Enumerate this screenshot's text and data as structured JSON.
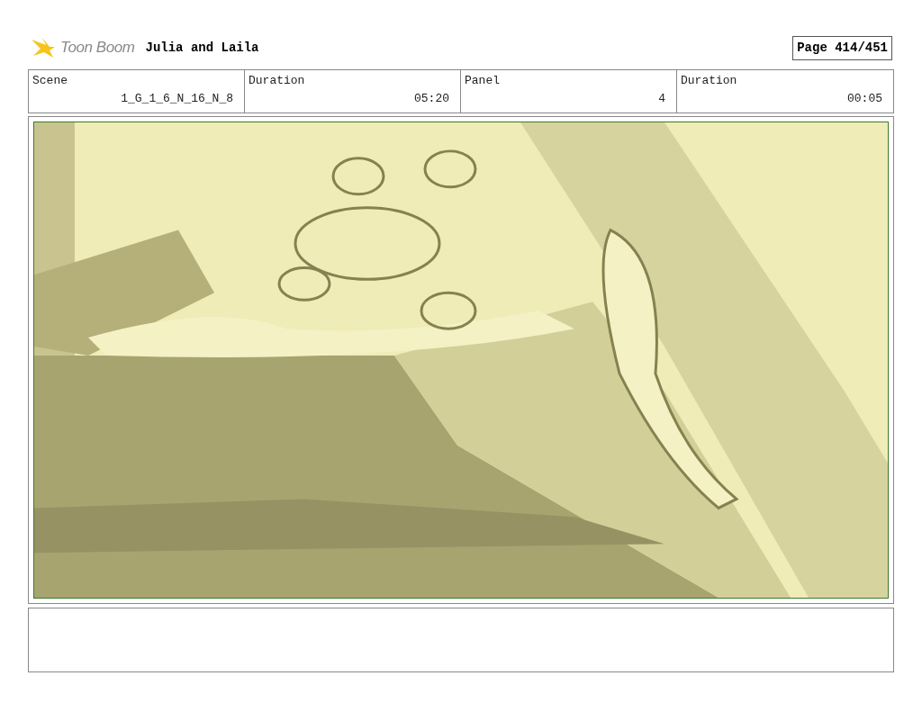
{
  "header": {
    "logo": "Toon Boom",
    "title": "Julia and Laila",
    "page": "Page 414/451"
  },
  "info": [
    {
      "label": "Scene",
      "value": "1_G_1_6_N_16_N_8"
    },
    {
      "label": "Duration",
      "value": "05:20"
    },
    {
      "label": "Panel",
      "value": "4"
    },
    {
      "label": "Duration",
      "value": "00:05"
    }
  ]
}
